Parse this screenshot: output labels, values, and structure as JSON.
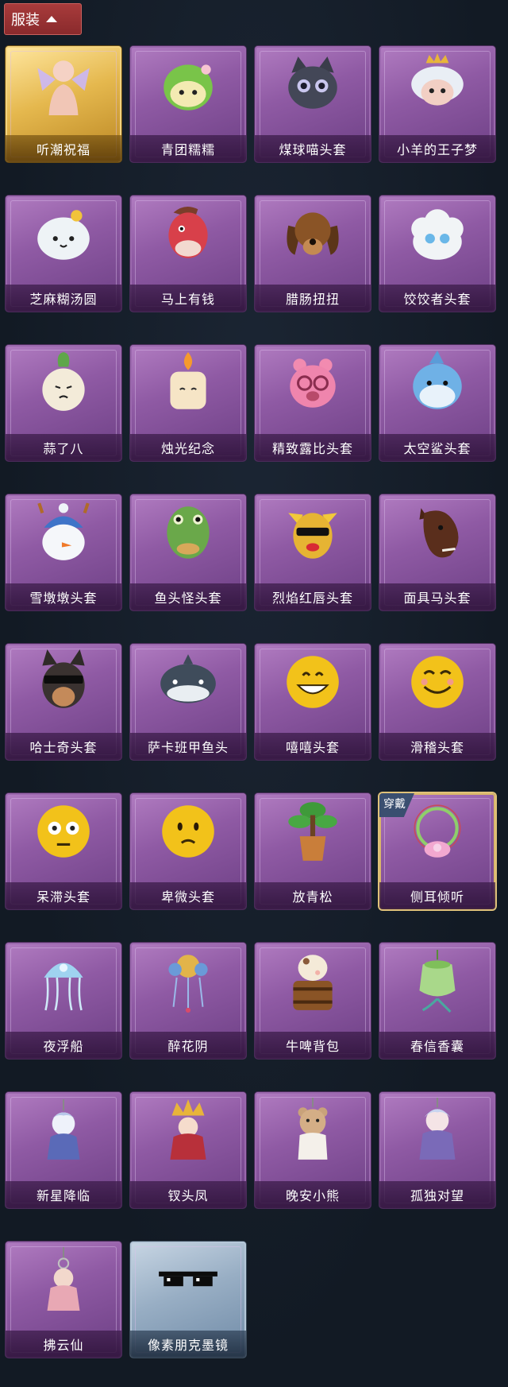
{
  "header": {
    "title": "服装"
  },
  "badges": {
    "equipped": "穿戴"
  },
  "items": [
    {
      "label": "听潮祝福",
      "icon": "angel-figure-icon"
    },
    {
      "label": "青团糯糯",
      "icon": "green-dumpling-head-icon"
    },
    {
      "label": "煤球喵头套",
      "icon": "black-cat-head-icon"
    },
    {
      "label": "小羊的王子梦",
      "icon": "sheep-crown-head-icon"
    },
    {
      "label": "芝麻糊汤圆",
      "icon": "rice-ball-head-icon"
    },
    {
      "label": "马上有钱",
      "icon": "red-horse-head-icon"
    },
    {
      "label": "腊肠扭扭",
      "icon": "dachshund-head-icon"
    },
    {
      "label": "饺饺者头套",
      "icon": "dumpling-cloud-head-icon"
    },
    {
      "label": "蒜了八",
      "icon": "garlic-head-icon"
    },
    {
      "label": "烛光纪念",
      "icon": "candle-head-icon"
    },
    {
      "label": "精致露比头套",
      "icon": "pink-beaver-head-icon"
    },
    {
      "label": "太空鲨头套",
      "icon": "space-shark-head-icon"
    },
    {
      "label": "雪墩墩头套",
      "icon": "snowman-head-icon"
    },
    {
      "label": "鱼头怪头套",
      "icon": "fish-head-icon"
    },
    {
      "label": "烈焰红唇头套",
      "icon": "yellow-mask-head-icon"
    },
    {
      "label": "面具马头套",
      "icon": "horse-mask-head-icon"
    },
    {
      "label": "哈士奇头套",
      "icon": "husky-sunglasses-head-icon"
    },
    {
      "label": "萨卡班甲鱼头",
      "icon": "round-fish-head-icon"
    },
    {
      "label": "嘻嘻头套",
      "icon": "grin-emoji-head-icon"
    },
    {
      "label": "滑稽头套",
      "icon": "smirk-emoji-head-icon"
    },
    {
      "label": "呆滞头套",
      "icon": "stare-emoji-head-icon"
    },
    {
      "label": "卑微头套",
      "icon": "humble-emoji-head-icon"
    },
    {
      "label": "放青松",
      "icon": "potted-pine-icon"
    },
    {
      "label": "侧耳倾听",
      "icon": "flower-wreath-icon"
    },
    {
      "label": "夜浮船",
      "icon": "jellyfish-ornament-icon"
    },
    {
      "label": "醉花阴",
      "icon": "flower-hairpin-icon"
    },
    {
      "label": "牛啤背包",
      "icon": "cow-barrel-backpack-icon"
    },
    {
      "label": "春信香囊",
      "icon": "green-sachet-icon"
    },
    {
      "label": "新星降临",
      "icon": "star-charm-icon"
    },
    {
      "label": "钗头凤",
      "icon": "phoenix-crown-charm-icon"
    },
    {
      "label": "晚安小熊",
      "icon": "bear-charm-icon"
    },
    {
      "label": "孤独对望",
      "icon": "lonely-gaze-charm-icon"
    },
    {
      "label": "拂云仙",
      "icon": "cloud-fairy-charm-icon"
    },
    {
      "label": "像素朋克墨镜",
      "icon": "pixel-sunglasses-icon"
    }
  ]
}
